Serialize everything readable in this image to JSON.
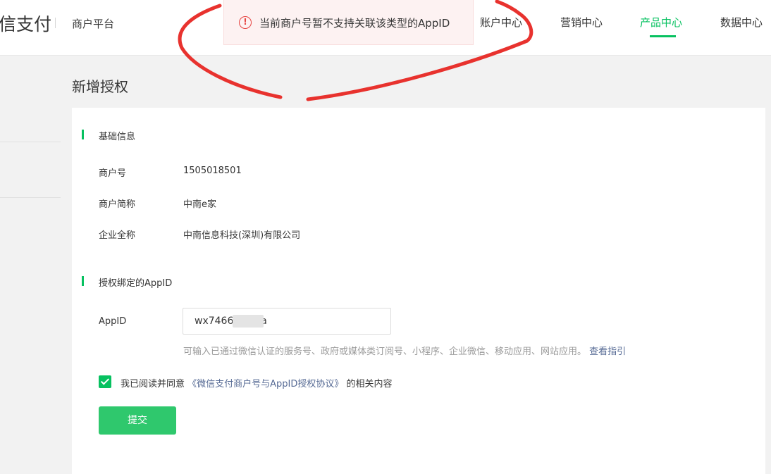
{
  "header": {
    "brand": "信支付",
    "platform": "商户平台",
    "nav": [
      {
        "label": "账户中心",
        "active": false
      },
      {
        "label": "营销中心",
        "active": false
      },
      {
        "label": "产品中心",
        "active": true
      },
      {
        "label": "数据中心",
        "active": false
      }
    ]
  },
  "toast": {
    "icon": "alert-circle-icon",
    "icon_glyph": "!",
    "message": "当前商户号暂不支持关联该类型的AppID"
  },
  "page": {
    "title": "新增授权"
  },
  "basic_info": {
    "heading": "基础信息",
    "merchant_id_label": "商户号",
    "merchant_id": "1505018501",
    "short_name_label": "商户简称",
    "short_name": "中南e家",
    "full_name_label": "企业全称",
    "full_name": "中南信息科技(深圳)有限公司"
  },
  "appid_section": {
    "heading": "授权绑定的AppID",
    "label": "AppID",
    "value": "wx7466        86c6a",
    "hint": "可输入已通过微信认证的服务号、政府或媒体类订阅号、小程序、企业微信、移动应用、网站应用。",
    "hint_link": "查看指引"
  },
  "agreement": {
    "checked": true,
    "prefix": "我已阅读并同意",
    "link": "《微信支付商户号与AppID授权协议》",
    "suffix": "的相关内容"
  },
  "submit_label": "提交",
  "colors": {
    "accent": "#07c160",
    "button": "#2fc86d",
    "link": "#576b95",
    "error": "#e64340",
    "annotation": "#e8322e"
  }
}
